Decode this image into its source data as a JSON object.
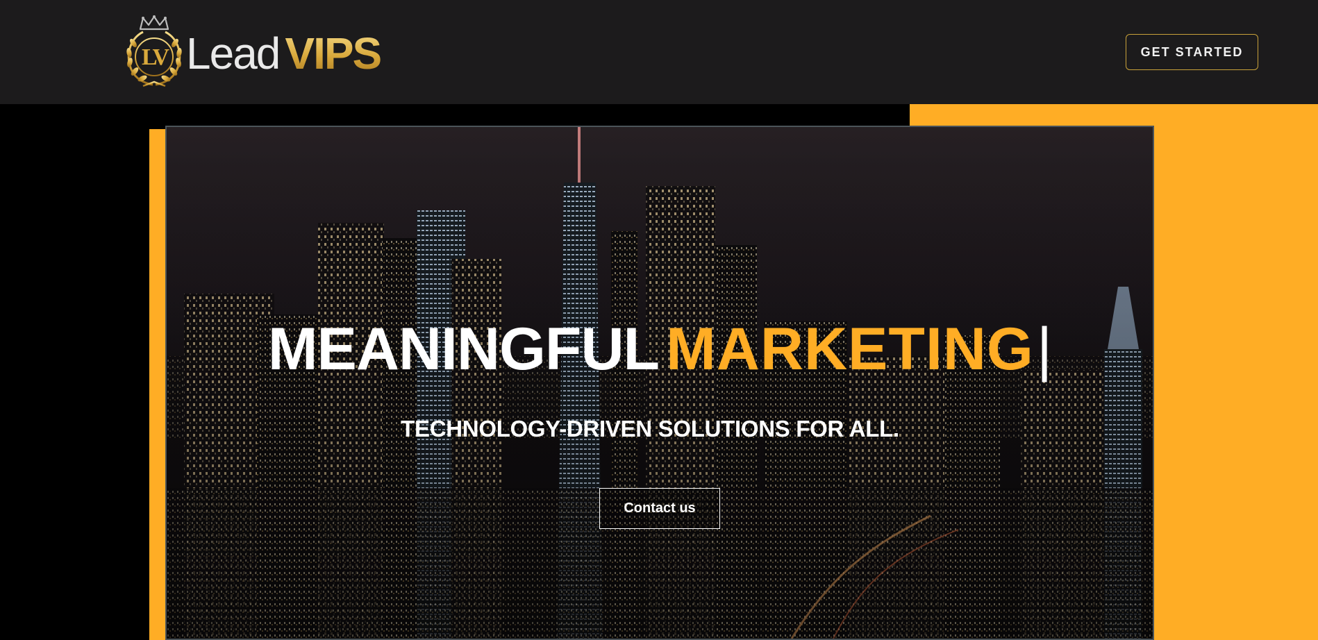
{
  "header": {
    "logo": {
      "monogram": "LV",
      "word_lead": "Lead",
      "word_vips": "VIPS"
    },
    "cta_label": "GET STARTED"
  },
  "hero": {
    "headline_primary": "MEANINGFUL",
    "headline_accent": "MARKETING",
    "caret": "|",
    "subheadline": "TECHNOLOGY-DRIVEN SOLUTIONS FOR ALL.",
    "contact_label": "Contact us",
    "background_image": "night-city-skyline"
  },
  "colors": {
    "accent": "#ffad25",
    "header_bg": "#1c1b1c",
    "page_bg": "#000000",
    "logo_gold": "#d9a93c",
    "button_border": "#c9a23a"
  }
}
